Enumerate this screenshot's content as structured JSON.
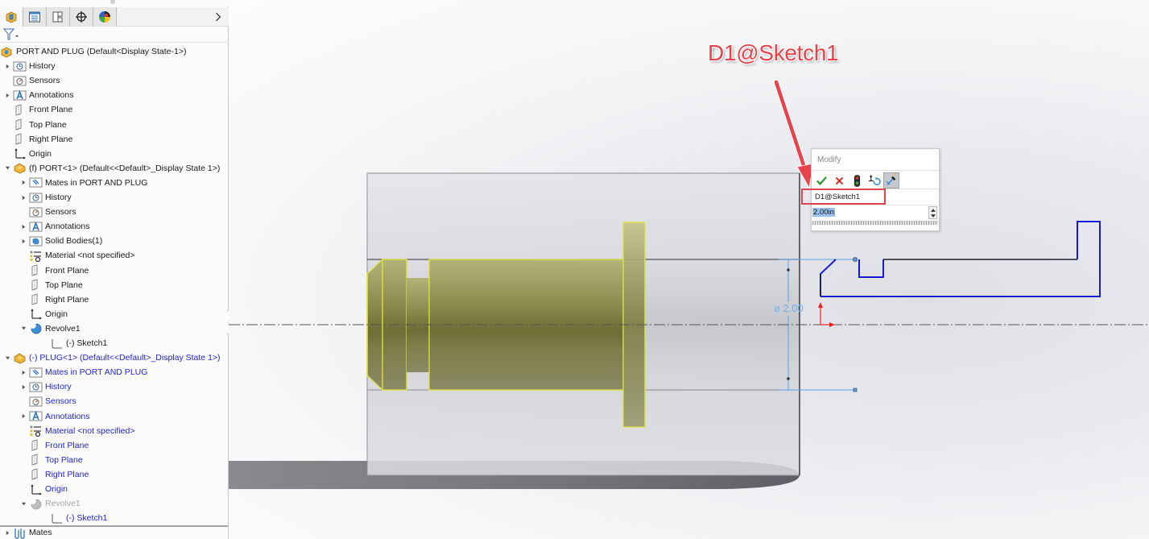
{
  "feature_tree": {
    "tabs": [
      {
        "name": "feature-manager",
        "icon": "part-assembly-icon",
        "active": true
      },
      {
        "name": "property-manager",
        "icon": "property-list-icon",
        "active": false
      },
      {
        "name": "configuration-manager",
        "icon": "configuration-icon",
        "active": false
      },
      {
        "name": "dim-xpert-manager",
        "icon": "crosshair-icon",
        "active": false
      },
      {
        "name": "display-manager",
        "icon": "appearance-sphere-icon",
        "active": false
      }
    ],
    "more_icon": "chevron-right-icon",
    "filter_icon": "funnel-filter-icon",
    "root": {
      "label": "PORT AND PLUG  (Default<Display State-1>)",
      "icon": "assembly-icon"
    },
    "items": [
      {
        "label": "History",
        "icon": "history-icon",
        "expander": "collapsed",
        "level": 1,
        "color": "black"
      },
      {
        "label": "Sensors",
        "icon": "sensors-icon",
        "expander": "none",
        "level": 1,
        "color": "black"
      },
      {
        "label": "Annotations",
        "icon": "annotations-icon",
        "expander": "collapsed",
        "level": 1,
        "color": "black"
      },
      {
        "label": "Front Plane",
        "icon": "plane-icon",
        "expander": "none",
        "level": 1,
        "color": "black"
      },
      {
        "label": "Top Plane",
        "icon": "plane-icon",
        "expander": "none",
        "level": 1,
        "color": "black"
      },
      {
        "label": "Right Plane",
        "icon": "plane-icon",
        "expander": "none",
        "level": 1,
        "color": "black"
      },
      {
        "label": "Origin",
        "icon": "origin-icon",
        "expander": "none",
        "level": 1,
        "color": "black"
      },
      {
        "label": "(f) PORT<1> (Default<<Default>_Display State 1>)",
        "icon": "part-icon",
        "expander": "expanded",
        "level": 0,
        "color": "black"
      },
      {
        "label": "Mates in PORT AND PLUG",
        "icon": "mates-folder-icon",
        "expander": "collapsed",
        "level": 2,
        "color": "black"
      },
      {
        "label": "History",
        "icon": "history-icon",
        "expander": "collapsed",
        "level": 2,
        "color": "black"
      },
      {
        "label": "Sensors",
        "icon": "sensors-icon",
        "expander": "none",
        "level": 2,
        "color": "black"
      },
      {
        "label": "Annotations",
        "icon": "annotations-icon",
        "expander": "collapsed",
        "level": 2,
        "color": "black"
      },
      {
        "label": "Solid Bodies(1)",
        "icon": "solid-bodies-icon",
        "expander": "collapsed",
        "level": 2,
        "color": "black"
      },
      {
        "label": "Material <not specified>",
        "icon": "material-icon",
        "expander": "none",
        "level": 2,
        "color": "black"
      },
      {
        "label": "Front Plane",
        "icon": "plane-icon",
        "expander": "none",
        "level": 2,
        "color": "black"
      },
      {
        "label": "Top Plane",
        "icon": "plane-icon",
        "expander": "none",
        "level": 2,
        "color": "black"
      },
      {
        "label": "Right Plane",
        "icon": "plane-icon",
        "expander": "none",
        "level": 2,
        "color": "black"
      },
      {
        "label": "Origin",
        "icon": "origin-icon",
        "expander": "none",
        "level": 2,
        "color": "black"
      },
      {
        "label": "Revolve1",
        "icon": "revolve-icon",
        "expander": "expanded",
        "level": 2,
        "color": "black"
      },
      {
        "label": "(-) Sketch1",
        "icon": "sketch-icon",
        "expander": "none",
        "level": 3,
        "color": "black"
      },
      {
        "label": "(-) PLUG<1> (Default<<Default>_Display State 1>)",
        "icon": "part-icon",
        "expander": "expanded",
        "level": 0,
        "color": "blue"
      },
      {
        "label": "Mates in PORT AND PLUG",
        "icon": "mates-folder-icon",
        "expander": "collapsed",
        "level": 2,
        "color": "blue"
      },
      {
        "label": "History",
        "icon": "history-icon",
        "expander": "collapsed",
        "level": 2,
        "color": "blue"
      },
      {
        "label": "Sensors",
        "icon": "sensors-icon",
        "expander": "none",
        "level": 2,
        "color": "blue"
      },
      {
        "label": "Annotations",
        "icon": "annotations-icon",
        "expander": "collapsed",
        "level": 2,
        "color": "blue"
      },
      {
        "label": "Material <not specified>",
        "icon": "material-icon",
        "expander": "none",
        "level": 2,
        "color": "blue"
      },
      {
        "label": "Front Plane",
        "icon": "plane-icon",
        "expander": "none",
        "level": 2,
        "color": "blue"
      },
      {
        "label": "Top Plane",
        "icon": "plane-icon",
        "expander": "none",
        "level": 2,
        "color": "blue"
      },
      {
        "label": "Right Plane",
        "icon": "plane-icon",
        "expander": "none",
        "level": 2,
        "color": "blue"
      },
      {
        "label": "Origin",
        "icon": "origin-icon",
        "expander": "none",
        "level": 2,
        "color": "blue"
      },
      {
        "label": "Revolve1",
        "icon": "revolve-icon",
        "expander": "expanded",
        "level": 2,
        "color": "gray"
      },
      {
        "label": "(-) Sketch1",
        "icon": "sketch-icon",
        "expander": "none",
        "level": 3,
        "color": "blue"
      }
    ],
    "footer": {
      "label": "Mates",
      "icon": "mates-icon",
      "expander": "collapsed"
    }
  },
  "graphics": {
    "callout_text": "D1@Sketch1",
    "dimension_label": "⌀ 2.00",
    "colors": {
      "sketch_line": "#1a1ad2",
      "dimension": "#5aa0e8",
      "plug_fill": "#9a9a4a",
      "plug_edge": "#e6e63a",
      "annotation_red": "#e8434b"
    }
  },
  "modify_dialog": {
    "title": "Modify",
    "buttons": [
      {
        "name": "ok",
        "icon": "checkmark-icon"
      },
      {
        "name": "cancel",
        "icon": "close-x-icon"
      },
      {
        "name": "rebuild",
        "icon": "traffic-light-icon"
      },
      {
        "name": "reverse-sense",
        "icon": "reverse-dimension-icon"
      },
      {
        "name": "mark-for-drawing",
        "icon": "mark-dimension-icon",
        "pressed": true
      }
    ],
    "dimension_name": "D1@Sketch1",
    "value": "2.00in"
  }
}
